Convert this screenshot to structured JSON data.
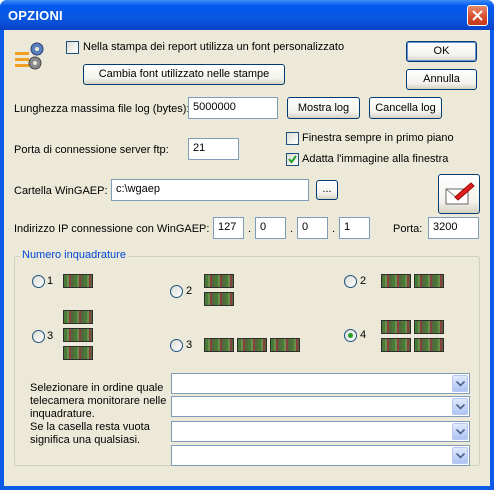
{
  "window": {
    "title": "OPZIONI"
  },
  "top": {
    "font_checkbox_label": "Nella stampa dei report utilizza un font personalizzato",
    "font_checkbox_checked": false,
    "change_font_button": "Cambia font utilizzato nelle stampe",
    "ok_button": "OK",
    "cancel_button": "Annulla"
  },
  "log": {
    "label": "Lunghezza massima file log (bytes):",
    "value": "5000000",
    "show_button": "Mostra log",
    "clear_button": "Cancella log"
  },
  "ftp": {
    "label": "Porta di connessione server ftp:",
    "value": "21"
  },
  "window_options": {
    "on_top_label": "Finestra sempre in primo piano",
    "on_top_checked": false,
    "fit_image_label": "Adatta l'immagine alla finestra",
    "fit_image_checked": true
  },
  "folder": {
    "label": "Cartella WinGAEP:",
    "value": "c:\\wgaep",
    "browse_button": "..."
  },
  "ip": {
    "label": "Indirizzo IP connessione con WinGAEP:",
    "octets": [
      "127",
      "0",
      "0",
      "1"
    ],
    "dot": ".",
    "port_label": "Porta:",
    "port_value": "3200"
  },
  "layout": {
    "group_label": "Numero inquadrature",
    "options": [
      {
        "label": "1",
        "selected": false
      },
      {
        "label": "2",
        "selected": false
      },
      {
        "label": "2",
        "selected": false
      },
      {
        "label": "3",
        "selected": false
      },
      {
        "label": "3",
        "selected": false
      },
      {
        "label": "4",
        "selected": true
      }
    ],
    "instructions": [
      "Selezionare in ordine quale",
      "telecamera monitorare nelle",
      "inquadrature.",
      "Se la casella resta vuota",
      "significa una qualsiasi."
    ],
    "camera_selects": [
      "",
      "",
      "",
      ""
    ]
  },
  "icons": {
    "settings": "gears-icon",
    "mail": "mail-edit-icon"
  },
  "colors": {
    "title_bar": "#0a5ce8",
    "dialog_bg": "#ece9d8",
    "group_label": "#0046d5",
    "check_green": "#21a121"
  }
}
